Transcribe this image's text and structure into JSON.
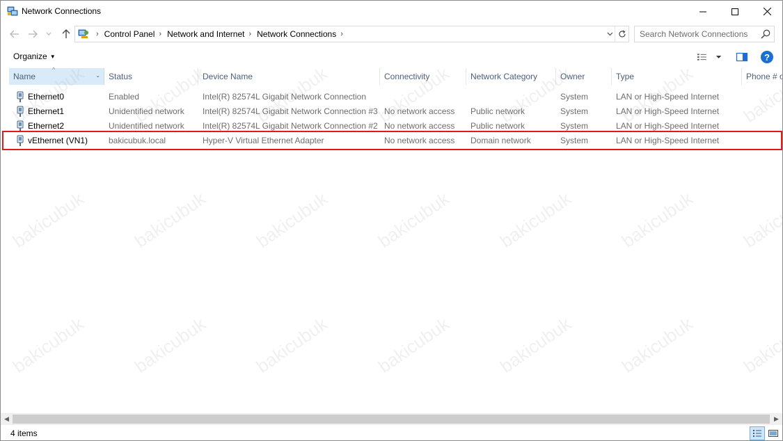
{
  "window": {
    "title": "Network Connections"
  },
  "nav": {
    "breadcrumbs": [
      "Control Panel",
      "Network and Internet",
      "Network Connections"
    ],
    "search_placeholder": "Search Network Connections"
  },
  "toolbar": {
    "organize_label": "Organize"
  },
  "columns": {
    "name": "Name",
    "status": "Status",
    "device": "Device Name",
    "connectivity": "Connectivity",
    "category": "Network Category",
    "owner": "Owner",
    "type": "Type",
    "phone": "Phone # o"
  },
  "connections": [
    {
      "name": "Ethernet0",
      "status": "Enabled",
      "device": "Intel(R) 82574L Gigabit Network Connection",
      "connectivity": "",
      "category": "",
      "owner": "System",
      "type": "LAN or High-Speed Internet"
    },
    {
      "name": "Ethernet1",
      "status": "Unidentified network",
      "device": "Intel(R) 82574L Gigabit Network Connection #3",
      "connectivity": "No network access",
      "category": "Public network",
      "owner": "System",
      "type": "LAN or High-Speed Internet"
    },
    {
      "name": "Ethernet2",
      "status": "Unidentified network",
      "device": "Intel(R) 82574L Gigabit Network Connection #2",
      "connectivity": "No network access",
      "category": "Public network",
      "owner": "System",
      "type": "LAN or High-Speed Internet"
    },
    {
      "name": "vEthernet (VN1)",
      "status": "bakicubuk.local",
      "device": "Hyper-V Virtual Ethernet Adapter",
      "connectivity": "No network access",
      "category": "Domain network",
      "owner": "System",
      "type": "LAN or High-Speed Internet"
    }
  ],
  "statusbar": {
    "item_count": "4 items"
  },
  "watermark": "bakicubuk",
  "colors": {
    "highlight_border": "#e01a1a",
    "selected_header": "#d9ebf9",
    "help_blue": "#1a6fd1"
  }
}
